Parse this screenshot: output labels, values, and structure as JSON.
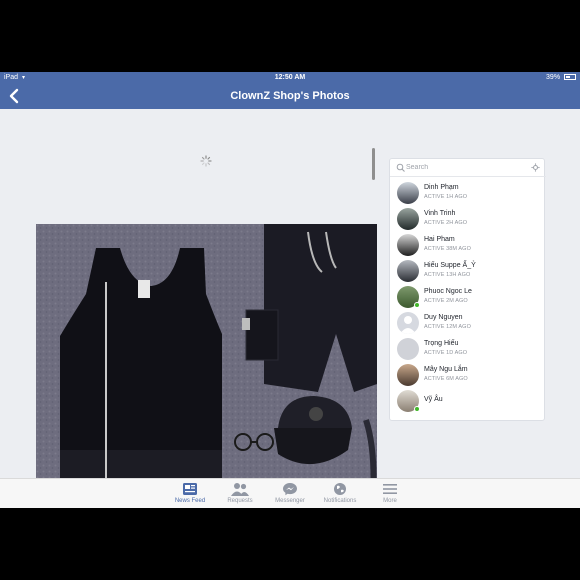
{
  "status_bar": {
    "device": "iPad",
    "time": "12:50 AM",
    "battery": "39%"
  },
  "navbar": {
    "title": "ClownZ Shop's Photos"
  },
  "search": {
    "placeholder": "Search"
  },
  "contacts": [
    {
      "name": "Dinh Phạm",
      "status": "ACTIVE 1H AGO",
      "online": false
    },
    {
      "name": "Vinh Trinh",
      "status": "ACTIVE 2H AGO",
      "online": false
    },
    {
      "name": "Hai Pham",
      "status": "ACTIVE 38M AGO",
      "online": false
    },
    {
      "name": "Hiếu Suppe Ẩ_Ỷ",
      "status": "ACTIVE 13H AGO",
      "online": false
    },
    {
      "name": "Phuoc Ngoc Le",
      "status": "ACTIVE 2M AGO",
      "online": true
    },
    {
      "name": "Duy Nguyen",
      "status": "ACTIVE 12M AGO",
      "online": false
    },
    {
      "name": "Trọng Hiếu",
      "status": "ACTIVE 1D AGO",
      "online": false
    },
    {
      "name": "Mây Ngu Lắm",
      "status": "ACTIVE 6M AGO",
      "online": false
    },
    {
      "name": "Vỹ Âu",
      "status": "",
      "online": true
    }
  ],
  "tabs": [
    {
      "label": "News Feed",
      "icon": "news-feed-icon",
      "active": true
    },
    {
      "label": "Requests",
      "icon": "friends-icon",
      "active": false
    },
    {
      "label": "Messenger",
      "icon": "messenger-icon",
      "active": false
    },
    {
      "label": "Notifications",
      "icon": "globe-icon",
      "active": false
    },
    {
      "label": "More",
      "icon": "menu-icon",
      "active": false
    }
  ],
  "colors": {
    "brand": "#4b6aa8",
    "online": "#42b72a",
    "active_tab": "#4b6aa8",
    "inactive_tab": "#9197a3"
  }
}
